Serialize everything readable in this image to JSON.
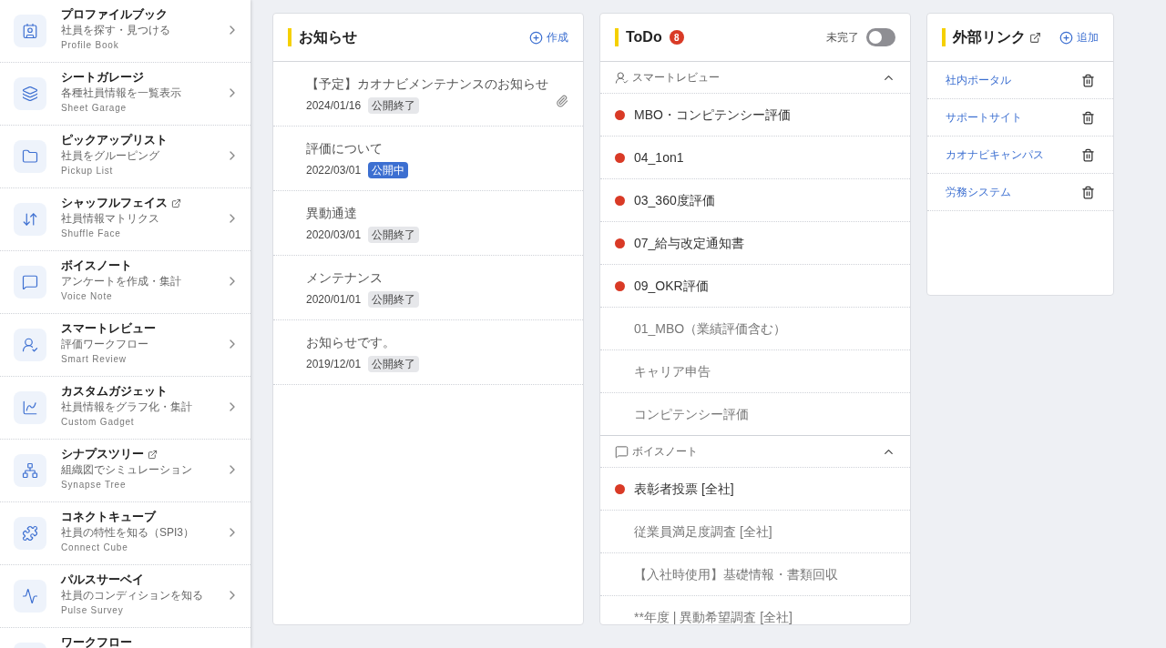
{
  "sidebar": {
    "items": [
      {
        "title": "プロファイルブック",
        "subtitle": "社員を探す・見つける",
        "english": "Profile Book",
        "external": false
      },
      {
        "title": "シートガレージ",
        "subtitle": "各種社員情報を一覧表示",
        "english": "Sheet Garage",
        "external": false
      },
      {
        "title": "ピックアップリスト",
        "subtitle": "社員をグルーピング",
        "english": "Pickup List",
        "external": false
      },
      {
        "title": "シャッフルフェイス",
        "subtitle": "社員情報マトリクス",
        "english": "Shuffle Face",
        "external": true
      },
      {
        "title": "ボイスノート",
        "subtitle": "アンケートを作成・集計",
        "english": "Voice Note",
        "external": false
      },
      {
        "title": "スマートレビュー",
        "subtitle": "評価ワークフロー",
        "english": "Smart Review",
        "external": false
      },
      {
        "title": "カスタムガジェット",
        "subtitle": "社員情報をグラフ化・集計",
        "english": "Custom Gadget",
        "external": false
      },
      {
        "title": "シナプスツリー",
        "subtitle": "組織図でシミュレーション",
        "english": "Synapse Tree",
        "external": true
      },
      {
        "title": "コネクトキューブ",
        "subtitle": "社員の特性を知る（SPI3）",
        "english": "Connect Cube",
        "external": false
      },
      {
        "title": "パルスサーベイ",
        "subtitle": "社員のコンディションを知る",
        "english": "Pulse Survey",
        "external": false
      },
      {
        "title": "ワークフロー",
        "external": false
      }
    ]
  },
  "notices": {
    "title": "お知らせ",
    "action": "作成",
    "items": [
      {
        "title": "【予定】カオナビメンテナンスのお知らせ",
        "date": "2024/01/16",
        "status": "公開終了",
        "published": false,
        "attachment": true
      },
      {
        "title": "評価について",
        "date": "2022/03/01",
        "status": "公開中",
        "published": true,
        "attachment": false
      },
      {
        "title": "異動通達",
        "date": "2020/03/01",
        "status": "公開終了",
        "published": false,
        "attachment": false
      },
      {
        "title": "メンテナンス",
        "date": "2020/01/01",
        "status": "公開終了",
        "published": false,
        "attachment": false
      },
      {
        "title": "お知らせです。",
        "date": "2019/12/01",
        "status": "公開終了",
        "published": false,
        "attachment": false
      }
    ]
  },
  "todo": {
    "title": "ToDo",
    "badge": "8",
    "toggle": {
      "label": "未完了",
      "on": false
    },
    "sections": [
      {
        "title": "スマートレビュー",
        "expanded": true,
        "items": [
          {
            "text": "MBO・コンピテンシー評価",
            "pending": true
          },
          {
            "text": "04_1on1",
            "pending": true
          },
          {
            "text": "03_360度評価",
            "pending": true
          },
          {
            "text": "07_給与改定通知書",
            "pending": true
          },
          {
            "text": "09_OKR評価",
            "pending": true
          },
          {
            "text": "01_MBO（業績評価含む）",
            "pending": false
          },
          {
            "text": "キャリア申告",
            "pending": false
          },
          {
            "text": "コンピテンシー評価",
            "pending": false
          }
        ]
      },
      {
        "title": "ボイスノート",
        "expanded": true,
        "items": [
          {
            "text": "表彰者投票 [全社]",
            "pending": true
          },
          {
            "text": "従業員満足度調査 [全社]",
            "pending": false
          },
          {
            "text": "【入社時使用】基礎情報・書類回収",
            "pending": false
          },
          {
            "text": "**年度 | 異動希望調査 [全社]",
            "pending": false
          }
        ]
      }
    ]
  },
  "links": {
    "title": "外部リンク",
    "external": true,
    "action": "追加",
    "items": [
      {
        "text": "社内ポータル"
      },
      {
        "text": "サポートサイト"
      },
      {
        "text": "カオナビキャンパス"
      },
      {
        "text": "労務システム"
      }
    ]
  }
}
